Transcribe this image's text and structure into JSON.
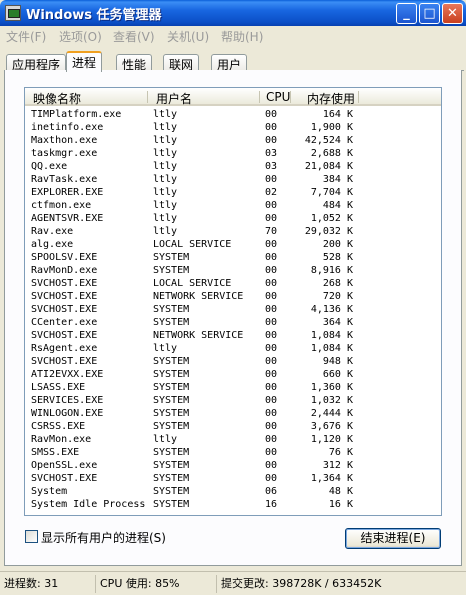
{
  "window": {
    "title": "Windows 任务管理器",
    "minimize_glyph": "_",
    "maximize_glyph": "□",
    "close_glyph": "✕"
  },
  "menu": [
    {
      "label": "文件(F)"
    },
    {
      "label": "选项(O)"
    },
    {
      "label": "查看(V)"
    },
    {
      "label": "关机(U)"
    },
    {
      "label": "帮助(H)"
    }
  ],
  "tabs": [
    {
      "label": "应用程序"
    },
    {
      "label": "进程",
      "active": true
    },
    {
      "label": "性能"
    },
    {
      "label": "联网"
    },
    {
      "label": "用户"
    }
  ],
  "columns": {
    "name": "映像名称",
    "user": "用户名",
    "cpu": "CPU",
    "mem": "内存使用"
  },
  "processes": [
    {
      "name": "TIMPlatform.exe",
      "user": "ltly",
      "cpu": "00",
      "mem": "164 K"
    },
    {
      "name": "inetinfo.exe",
      "user": "ltly",
      "cpu": "00",
      "mem": "1,900 K"
    },
    {
      "name": "Maxthon.exe",
      "user": "ltly",
      "cpu": "00",
      "mem": "42,524 K"
    },
    {
      "name": "taskmgr.exe",
      "user": "ltly",
      "cpu": "03",
      "mem": "2,688 K"
    },
    {
      "name": "QQ.exe",
      "user": "ltly",
      "cpu": "03",
      "mem": "21,084 K"
    },
    {
      "name": "RavTask.exe",
      "user": "ltly",
      "cpu": "00",
      "mem": "384 K"
    },
    {
      "name": "EXPLORER.EXE",
      "user": "ltly",
      "cpu": "02",
      "mem": "7,704 K"
    },
    {
      "name": "ctfmon.exe",
      "user": "ltly",
      "cpu": "00",
      "mem": "484 K"
    },
    {
      "name": "AGENTSVR.EXE",
      "user": "ltly",
      "cpu": "00",
      "mem": "1,052 K"
    },
    {
      "name": "Rav.exe",
      "user": "ltly",
      "cpu": "70",
      "mem": "29,032 K"
    },
    {
      "name": "alg.exe",
      "user": "LOCAL SERVICE",
      "cpu": "00",
      "mem": "200 K"
    },
    {
      "name": "SPOOLSV.EXE",
      "user": "SYSTEM",
      "cpu": "00",
      "mem": "528 K"
    },
    {
      "name": "RavMonD.exe",
      "user": "SYSTEM",
      "cpu": "00",
      "mem": "8,916 K"
    },
    {
      "name": "SVCHOST.EXE",
      "user": "LOCAL SERVICE",
      "cpu": "00",
      "mem": "268 K"
    },
    {
      "name": "SVCHOST.EXE",
      "user": "NETWORK SERVICE",
      "cpu": "00",
      "mem": "720 K"
    },
    {
      "name": "SVCHOST.EXE",
      "user": "SYSTEM",
      "cpu": "00",
      "mem": "4,136 K"
    },
    {
      "name": "CCenter.exe",
      "user": "SYSTEM",
      "cpu": "00",
      "mem": "364 K"
    },
    {
      "name": "SVCHOST.EXE",
      "user": "NETWORK SERVICE",
      "cpu": "00",
      "mem": "1,084 K"
    },
    {
      "name": "RsAgent.exe",
      "user": "ltly",
      "cpu": "00",
      "mem": "1,084 K"
    },
    {
      "name": "SVCHOST.EXE",
      "user": "SYSTEM",
      "cpu": "00",
      "mem": "948 K"
    },
    {
      "name": "ATI2EVXX.EXE",
      "user": "SYSTEM",
      "cpu": "00",
      "mem": "660 K"
    },
    {
      "name": "LSASS.EXE",
      "user": "SYSTEM",
      "cpu": "00",
      "mem": "1,360 K"
    },
    {
      "name": "SERVICES.EXE",
      "user": "SYSTEM",
      "cpu": "00",
      "mem": "1,032 K"
    },
    {
      "name": "WINLOGON.EXE",
      "user": "SYSTEM",
      "cpu": "00",
      "mem": "2,444 K"
    },
    {
      "name": "CSRSS.EXE",
      "user": "SYSTEM",
      "cpu": "00",
      "mem": "3,676 K"
    },
    {
      "name": "RavMon.exe",
      "user": "ltly",
      "cpu": "00",
      "mem": "1,120 K"
    },
    {
      "name": "SMSS.EXE",
      "user": "SYSTEM",
      "cpu": "00",
      "mem": "76 K"
    },
    {
      "name": "OpenSSL.exe",
      "user": "SYSTEM",
      "cpu": "00",
      "mem": "312 K"
    },
    {
      "name": "SVCHOST.EXE",
      "user": "SYSTEM",
      "cpu": "00",
      "mem": "1,364 K"
    },
    {
      "name": "System",
      "user": "SYSTEM",
      "cpu": "06",
      "mem": "48 K"
    },
    {
      "name": "System Idle Process",
      "user": "SYSTEM",
      "cpu": "16",
      "mem": "16 K"
    }
  ],
  "show_all_users_label": "显示所有用户的进程(S)",
  "end_process_label": "结束进程(E)",
  "status": {
    "process_count": "进程数: 31",
    "cpu_usage": "CPU 使用: 85%",
    "commit_charge": "提交更改: 398728K / 633452K"
  }
}
